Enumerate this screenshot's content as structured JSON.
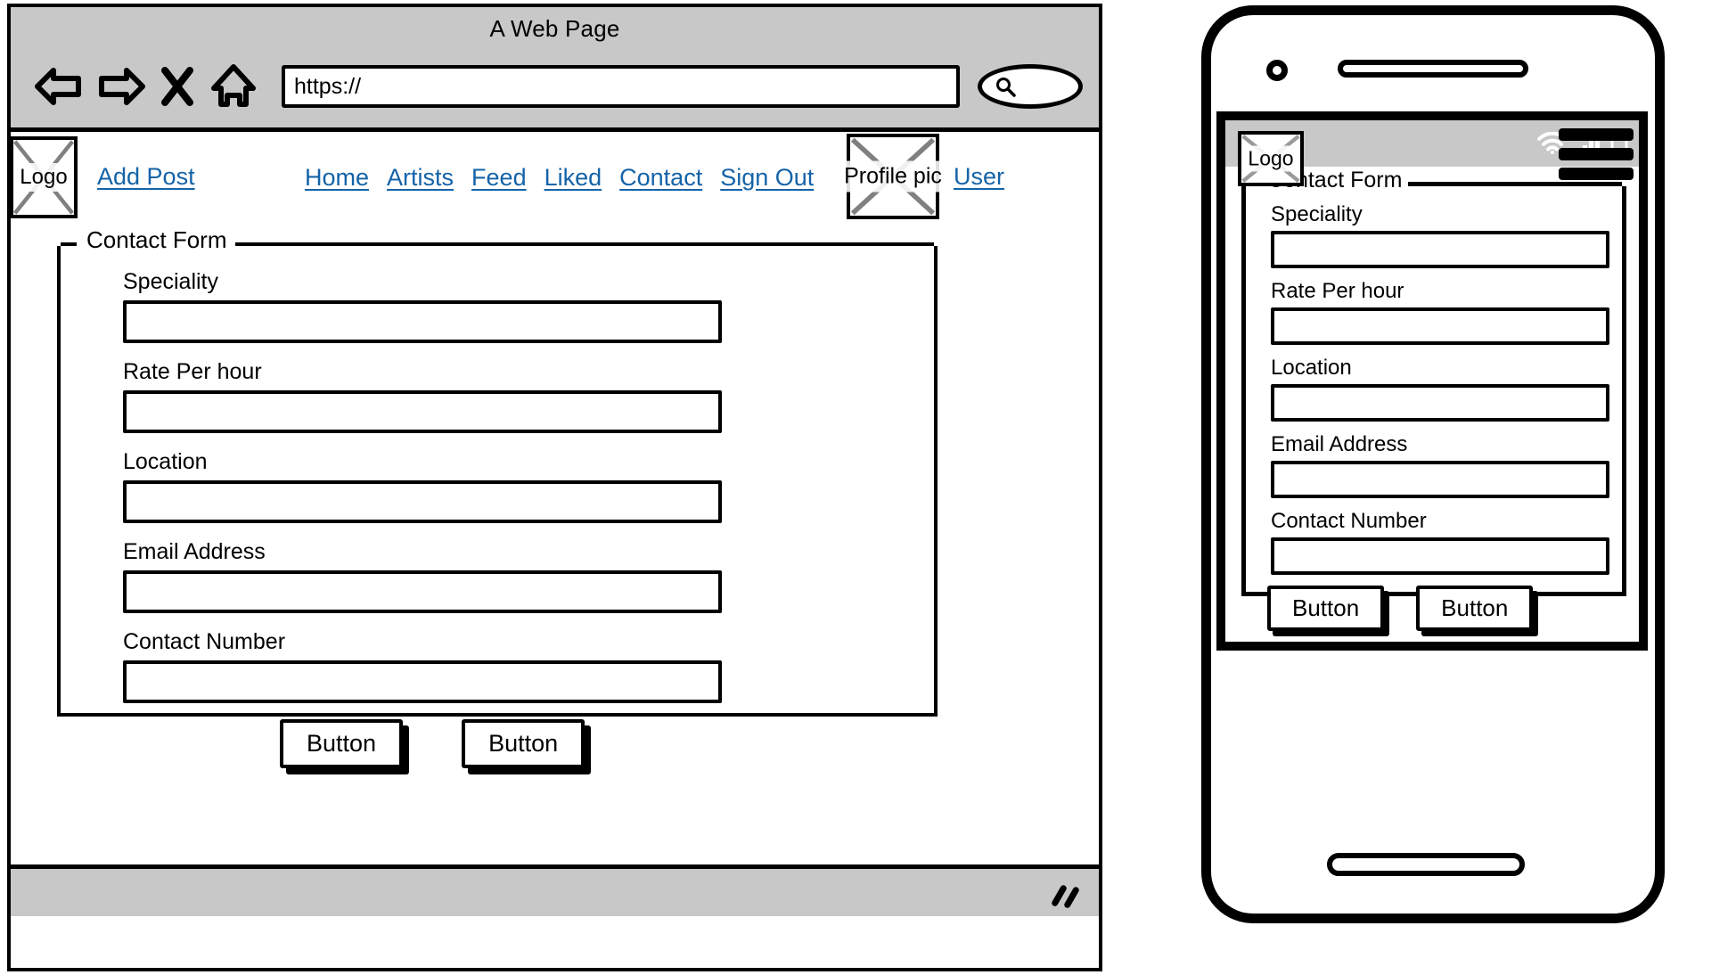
{
  "browser": {
    "window_title": "A Web Page",
    "url_value": "https://",
    "nav": {
      "back_label": "back-arrow",
      "forward_label": "forward-arrow",
      "stop_label": "X",
      "home_label": "home"
    },
    "search_icon": "search-icon"
  },
  "site_nav": {
    "logo_label": "Logo",
    "add_post": "Add Post",
    "links": [
      {
        "label": "Home"
      },
      {
        "label": "Artists"
      },
      {
        "label": "Feed"
      },
      {
        "label": "Liked"
      },
      {
        "label": "Contact"
      },
      {
        "label": "Sign Out"
      }
    ],
    "profile_pic_label": "Profile pic",
    "user_label": "User",
    "link_color": "#1463a8"
  },
  "form": {
    "legend": "Contact Form",
    "fields": [
      {
        "label": "Speciality",
        "value": "",
        "placeholder": ""
      },
      {
        "label": "Rate Per hour",
        "value": "",
        "placeholder": ""
      },
      {
        "label": "Location",
        "value": "",
        "placeholder": ""
      },
      {
        "label": "Email Address",
        "value": "",
        "placeholder": ""
      },
      {
        "label": "Contact Number",
        "value": "",
        "placeholder": ""
      }
    ],
    "buttons": [
      {
        "label": "Button"
      },
      {
        "label": "Button"
      }
    ]
  },
  "phone": {
    "status_icons": [
      "wifi-icon",
      "signal-icon",
      "battery-icon"
    ],
    "menu_icon": "hamburger-menu-icon",
    "logo_label": "Logo",
    "form": {
      "legend": "Contact Form",
      "fields": [
        {
          "label": "Speciality",
          "value": ""
        },
        {
          "label": "Rate Per hour",
          "value": ""
        },
        {
          "label": "Location",
          "value": ""
        },
        {
          "label": "Email Address",
          "value": ""
        },
        {
          "label": "Contact Number",
          "value": ""
        }
      ],
      "buttons": [
        {
          "label": "Button"
        },
        {
          "label": "Button"
        }
      ]
    }
  },
  "statusbar": {
    "resize_grip": "resize-grip-icon"
  }
}
